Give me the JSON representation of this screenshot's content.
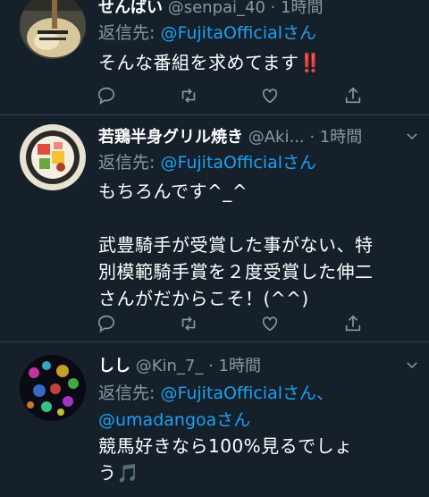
{
  "tweets": [
    {
      "name": "せんばい",
      "meta": " @senpai_40 · 1時間",
      "reply_prefix": "返信先: ",
      "reply_handles": "@FujitaOfficialさん",
      "reply_handles_2": "",
      "body_lines": [
        "そんな番組を求めてます‼️"
      ]
    },
    {
      "name": "若鶏半身グリル焼き",
      "meta": " @Aki... · 1時間",
      "reply_prefix": "返信先: ",
      "reply_handles": "@FujitaOfficialさん",
      "reply_handles_2": "",
      "body_lines": [
        "もちろんです^_^",
        "",
        "武豊騎手が受賞した事がない、特",
        "別模範騎手賞を２度受賞した伸二",
        "さんがだからこそ！(^^)"
      ]
    },
    {
      "name": "しし",
      "meta": " @Kin_7_ · 1時間",
      "reply_prefix": "返信先: ",
      "reply_handles": "@FujitaOfficialさん、",
      "reply_handles_2": "@umadangoaさん",
      "body_lines": [
        "競馬好きなら100%見るでしょ",
        "う🎵"
      ]
    }
  ],
  "icons": [
    "reply-icon",
    "retweet-icon",
    "like-icon",
    "share-icon",
    "chevron-down-icon"
  ],
  "colors": {
    "background": "#15202b",
    "link": "#1da1f2",
    "muted": "#8899a6",
    "divider": "#38444d"
  }
}
